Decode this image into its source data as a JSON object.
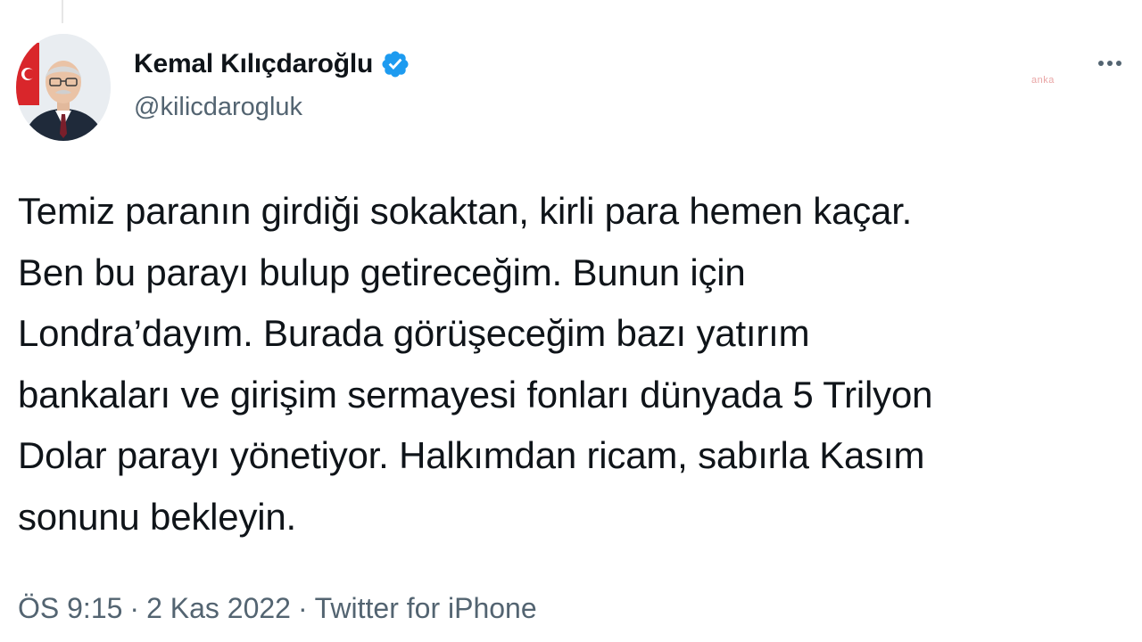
{
  "author": {
    "display_name": "Kemal Kılıçdaroğlu",
    "handle": "@kilicdarogluk",
    "verified": true
  },
  "watermark": "anka",
  "tweet": {
    "lines": [
      "Temiz paranın girdiği sokaktan, kirli para hemen kaçar.",
      "Ben bu parayı bulup getireceğim. Bunun için",
      "Londra’dayım. Burada görüşeceğim bazı yatırım",
      "bankaları ve girişim sermayesi fonları dünyada 5 Trilyon",
      "Dolar parayı yönetiyor. Halkımdan ricam, sabırla Kasım",
      "sonunu bekleyin."
    ]
  },
  "meta": {
    "time": "ÖS 9:15",
    "separator": "·",
    "date": "2 Kas 2022",
    "source": "Twitter for iPhone"
  },
  "icons": {
    "verified": "verified-badge-icon",
    "more": "more-options-icon"
  },
  "colors": {
    "text": "#0f1419",
    "secondary": "#536471",
    "verified": "#1d9bf0"
  }
}
